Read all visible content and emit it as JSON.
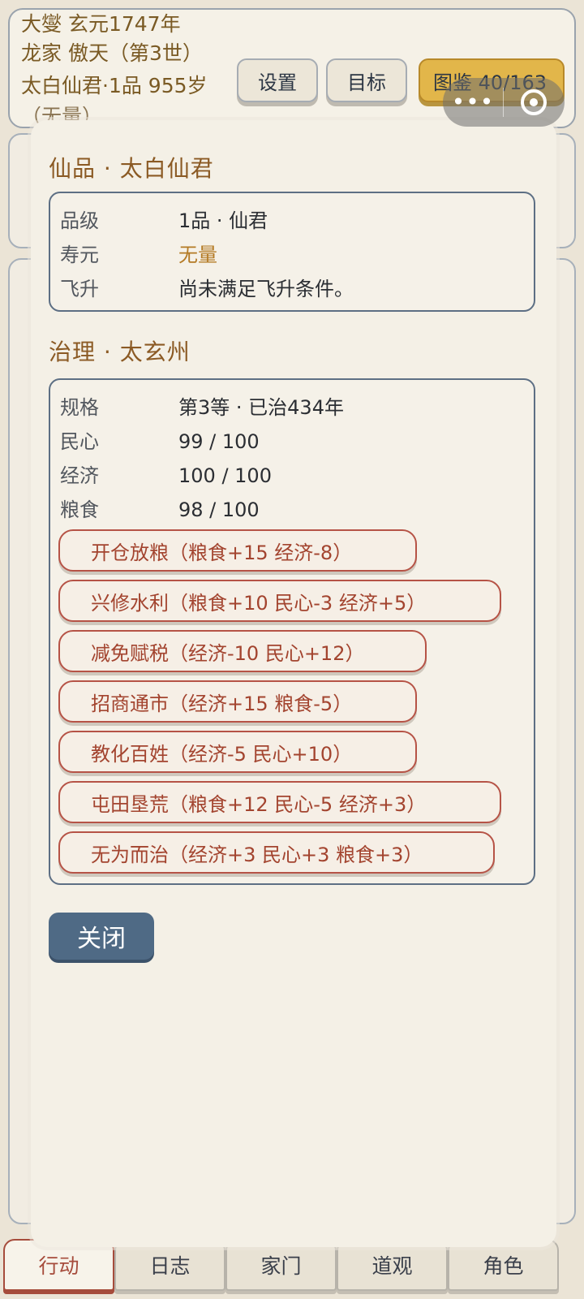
{
  "header": {
    "line1": "大燮 玄元1747年",
    "line2": "龙家 傲天（第3世）",
    "line3": "太白仙君·1品 955岁",
    "line4": "（无量）"
  },
  "top_buttons": {
    "settings": "设置",
    "goal": "目标",
    "atlas": "图鉴 40/163"
  },
  "capsule": {
    "more": "•••"
  },
  "modal": {
    "immortal_title": "仙品 · 太白仙君",
    "immortal_rows": [
      {
        "label": "品级",
        "value": "1品 · 仙君"
      },
      {
        "label": "寿元",
        "value": "无量"
      },
      {
        "label": "飞升",
        "value": "尚未满足飞升条件。"
      }
    ],
    "govern_title": "治理 · 太玄州",
    "govern_rows": [
      {
        "label": "规格",
        "value": "第3等 · 已治434年"
      },
      {
        "label": "民心",
        "value": "99 / 100"
      },
      {
        "label": "经济",
        "value": "100 / 100"
      },
      {
        "label": "粮食",
        "value": "98 / 100"
      }
    ],
    "actions": [
      "开仓放粮（粮食+15 经济-8）",
      "兴修水利（粮食+10 民心-3 经济+5）",
      "减免赋税（经济-10 民心+12）",
      "招商通市（经济+15 粮食-5）",
      "教化百姓（经济-5 民心+10）",
      "屯田垦荒（粮食+12 民心-5 经济+3）",
      "无为而治（经济+3 民心+3 粮食+3）"
    ],
    "close": "关闭"
  },
  "tabs": [
    "行动",
    "日志",
    "家门",
    "道观",
    "角色"
  ],
  "colors": {
    "accent_gold": "#b47a24",
    "action_red": "#a3442f",
    "close_blue": "#4f6a85"
  }
}
